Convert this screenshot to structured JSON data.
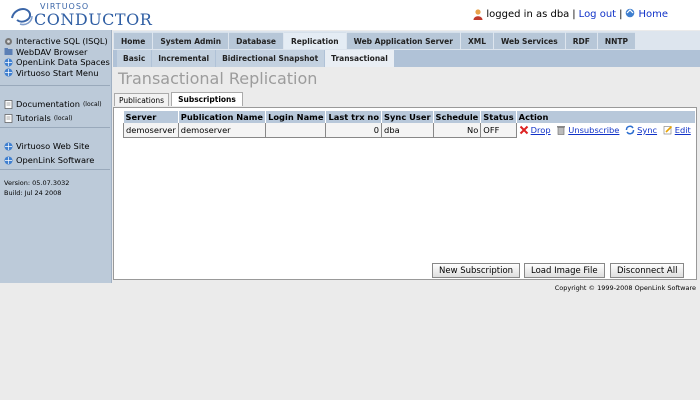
{
  "header": {
    "logo_top": "VIRTUOSO",
    "logo_main": "CONDUCTOR",
    "logged_in_text": "logged in as dba",
    "separator": "|",
    "logout": "Log out",
    "home": "Home"
  },
  "sidebar": {
    "group1": [
      "Interactive SQL (ISQL)",
      "WebDAV Browser",
      "OpenLink Data Spaces",
      "Virtuoso Start Menu"
    ],
    "group2": [
      {
        "label": "Documentation",
        "note": "(local)"
      },
      {
        "label": "Tutorials",
        "note": "(local)"
      }
    ],
    "group3": [
      "Virtuoso Web Site",
      "OpenLink Software"
    ],
    "version": "Version: 05.07.3032",
    "build": "Build: Jul 24 2008"
  },
  "nav": {
    "tabs": [
      "Home",
      "System Admin",
      "Database",
      "Replication",
      "Web Application Server",
      "XML",
      "Web Services",
      "RDF",
      "NNTP"
    ],
    "active_tab": "Replication",
    "subtabs": [
      "Basic",
      "Incremental",
      "Bidirectional Snapshot",
      "Transactional"
    ],
    "active_subtab": "Transactional"
  },
  "page": {
    "title": "Transactional Replication",
    "panel_tabs": [
      "Publications",
      "Subscriptions"
    ],
    "active_panel_tab": "Subscriptions"
  },
  "table": {
    "headers": [
      "Server",
      "Publication Name",
      "Login Name",
      "Last trx no",
      "Sync User",
      "Schedule",
      "Status",
      "Action"
    ],
    "rows": [
      {
        "server": "demoserver",
        "publication": "demoserver",
        "login": "",
        "last_trx": "0",
        "sync_user": "dba",
        "schedule": "No",
        "status": "OFF"
      }
    ],
    "actions": [
      "Drop",
      "Unsubscribe",
      "Sync",
      "Edit"
    ]
  },
  "buttons": {
    "new_subscription": "New Subscription",
    "load_image_file": "Load Image File",
    "disconnect_all": "Disconnect All"
  },
  "footer": {
    "copyright": "Copyright © 1999-2008 OpenLink Software"
  },
  "colors": {
    "sidebar_bg": "#bccad9",
    "tab_bg": "#b7c7d8",
    "link": "#1032c8",
    "header_row": "#b8c8da"
  }
}
